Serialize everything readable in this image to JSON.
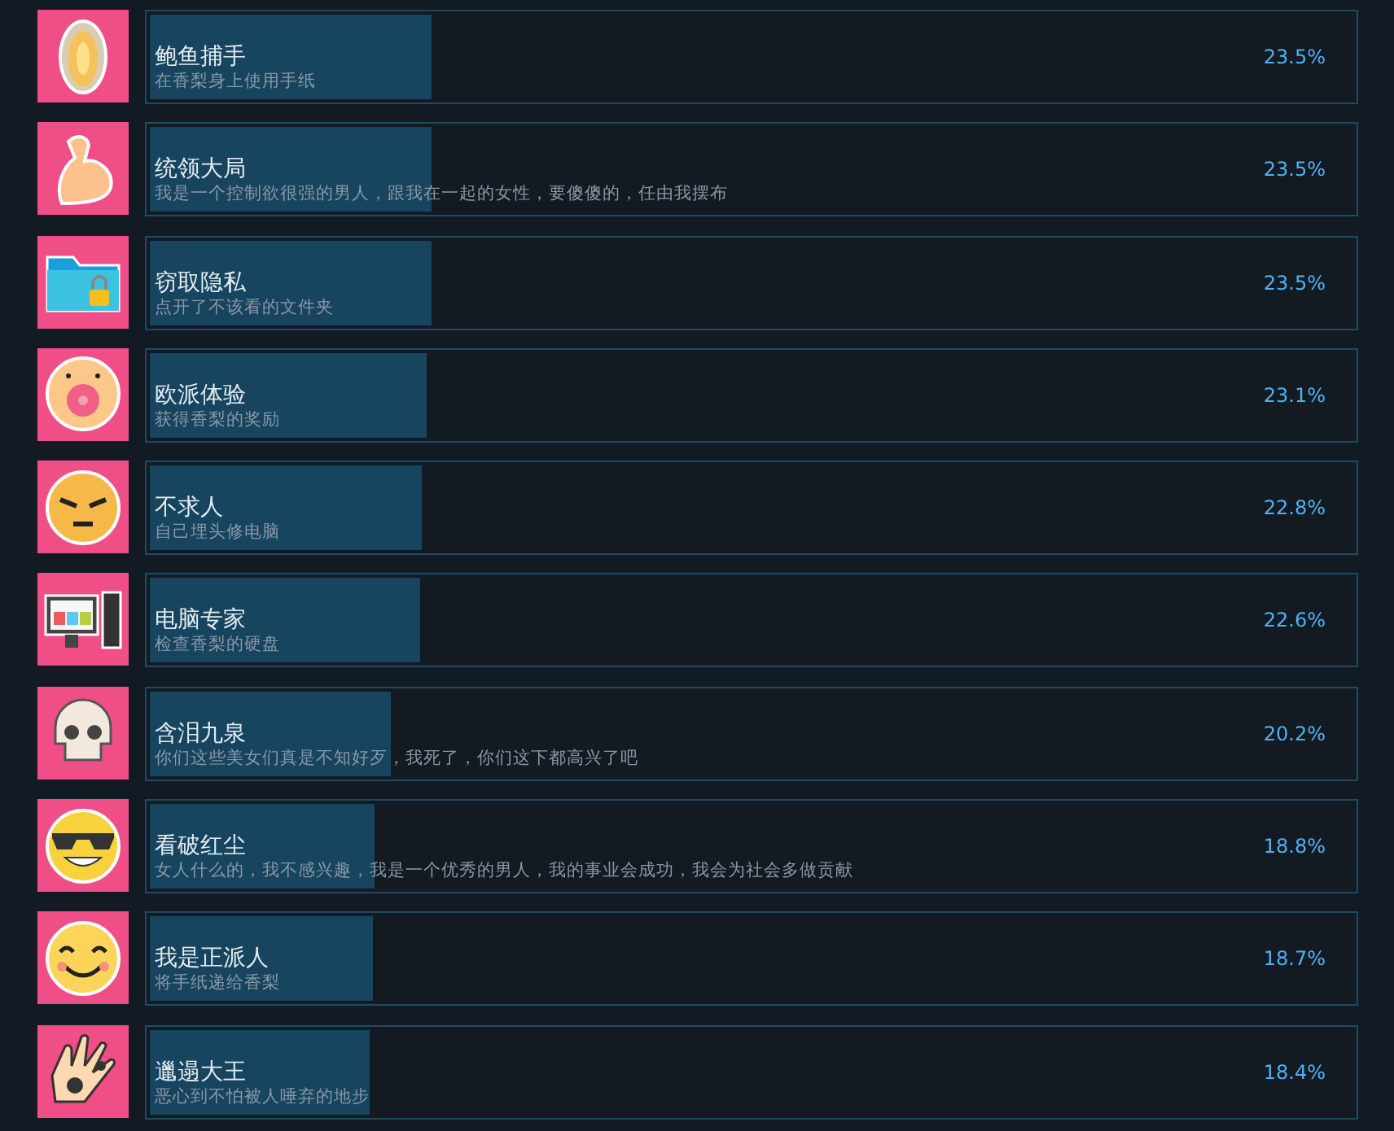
{
  "achievements": [
    {
      "title": "鲍鱼捕手",
      "description": "在香梨身上使用手纸",
      "percent": "23.5%",
      "level": 0.235
    },
    {
      "title": "统领大局",
      "description": "我是一个控制欲很强的男人，跟我在一起的女性，要傻傻的，任由我摆布",
      "percent": "23.5%",
      "level": 0.235
    },
    {
      "title": "窃取隐私",
      "description": "点开了不该看的文件夹",
      "percent": "23.5%",
      "level": 0.235
    },
    {
      "title": "欧派体验",
      "description": "获得香梨的奖励",
      "percent": "23.1%",
      "level": 0.231
    },
    {
      "title": "不求人",
      "description": "自己埋头修电脑",
      "percent": "22.8%",
      "level": 0.228
    },
    {
      "title": "电脑专家",
      "description": "检查香梨的硬盘",
      "percent": "22.6%",
      "level": 0.226
    },
    {
      "title": "含泪九泉",
      "description": "你们这些美女们真是不知好歹，我死了，你们这下都高兴了吧",
      "percent": "20.2%",
      "level": 0.202
    },
    {
      "title": "看破红尘",
      "description": "女人什么的，我不感兴趣，我是一个优秀的男人，我的事业会成功，我会为社会多做贡献",
      "percent": "18.8%",
      "level": 0.188
    },
    {
      "title": "我是正派人",
      "description": "将手纸递给香梨",
      "percent": "18.7%",
      "level": 0.187
    },
    {
      "title": "邋遢大王",
      "description": "恶心到不怕被人唾弃的地步",
      "percent": "18.4%",
      "level": 0.184
    }
  ]
}
